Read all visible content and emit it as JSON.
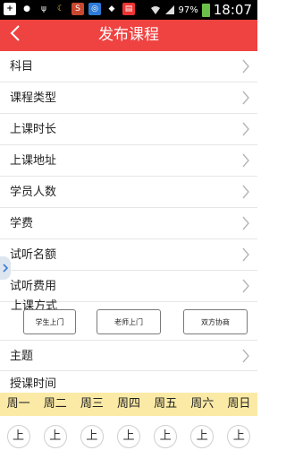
{
  "status_bar": {
    "battery_percent": "97%",
    "time": "18:07",
    "icons": [
      "plus-icon",
      "wechat-icon",
      "usb-icon",
      "moon-icon",
      "app-icon",
      "app-icon",
      "shield-icon",
      "news-icon",
      "wifi-icon",
      "signal-icon",
      "battery-icon"
    ]
  },
  "header": {
    "back_icon": "back-chevron-icon",
    "title": "发布课程"
  },
  "form": {
    "rows": [
      {
        "label": "科目"
      },
      {
        "label": "课程类型"
      },
      {
        "label": "上课时长"
      },
      {
        "label": "上课地址"
      },
      {
        "label": "学员人数"
      },
      {
        "label": "学费"
      },
      {
        "label": "试听名额"
      },
      {
        "label": "试听费用"
      }
    ],
    "mode": {
      "label": "上课方式",
      "options": [
        "学生上门",
        "老师上门",
        "双方协商"
      ]
    },
    "topic": {
      "label": "主题"
    },
    "schedule": {
      "label": "授课时间",
      "weekdays": [
        "周一",
        "周二",
        "周三",
        "周四",
        "周五",
        "周六",
        "周日"
      ],
      "slot_label": "上"
    }
  },
  "colors": {
    "header_bg": "#ef4341",
    "weekday_bar_bg": "#fbeaa5",
    "divider": "#e6e6e6"
  }
}
